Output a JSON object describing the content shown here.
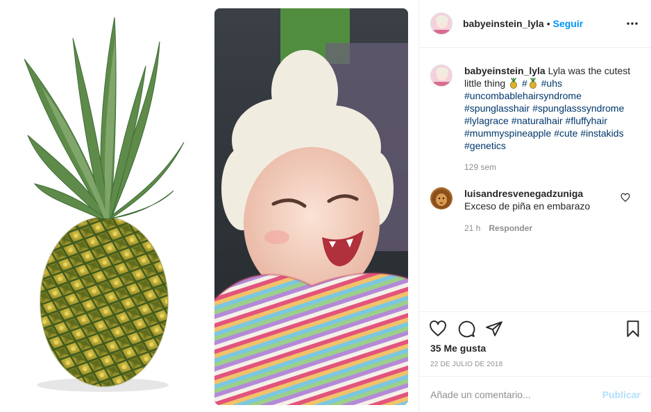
{
  "post": {
    "username": "babyeinstein_lyla",
    "separator": "•",
    "follow_label": "Seguir",
    "more_icon": "more-horizontal-icon"
  },
  "caption": {
    "username": "babyeinstein_lyla",
    "text": "Lyla was the cutest little thing",
    "emoji": "pineapple-emoji",
    "hashtags": [
      "#uhs",
      "#uncombablehairsyndrome",
      "#spunglasshair",
      "#spunglasssyndrome",
      "#lylagrace",
      "#naturalhair",
      "#fluffyhair",
      "#mummyspineapple",
      "#cute",
      "#instakids",
      "#genetics"
    ],
    "time_ago": "129 sem"
  },
  "comments": [
    {
      "username": "luisandresvenegadzuniga",
      "text": "Exceso de piña en embarazo",
      "time_ago": "21 h",
      "reply_label": "Responder"
    }
  ],
  "actions": {
    "like_icon": "heart-icon",
    "comment_icon": "comment-icon",
    "share_icon": "paper-plane-icon",
    "save_icon": "bookmark-icon"
  },
  "likes_text": "35 Me gusta",
  "date_text": "22 DE JULIO DE 2018",
  "comment_input": {
    "placeholder": "Añade un comentario...",
    "value": "",
    "publish_label": "Publicar"
  },
  "colors": {
    "accent": "#0095f6",
    "hashtag": "#00376b",
    "muted": "#8e8e8e",
    "publish_disabled": "#b2dffc"
  }
}
